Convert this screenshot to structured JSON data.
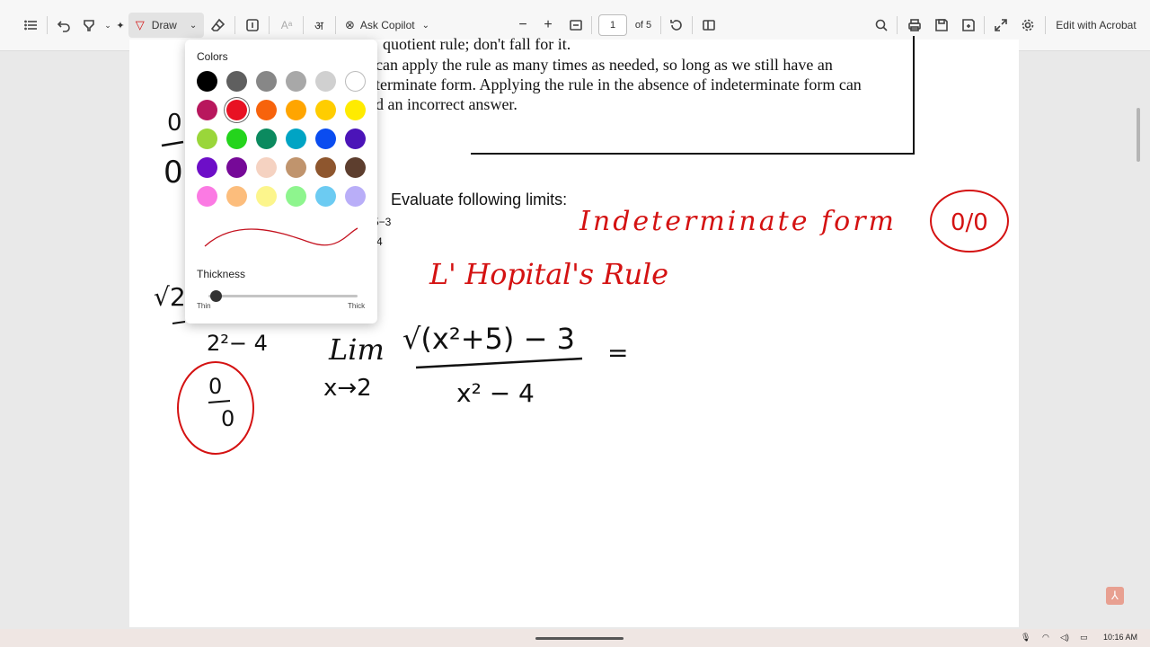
{
  "toolbar": {
    "draw_label": "Draw",
    "ask_copilot_label": "Ask Copilot",
    "page_number": "1",
    "page_total": "of 5",
    "edit_acrobat_label": "Edit with Acrobat"
  },
  "document": {
    "lines": [
      "quotient rule; don't fall for it.",
      "can apply the rule as many times as needed, so long as we still have an",
      "terminate form. Applying the rule in the absence of indeterminate form can",
      "d an incorrect answer."
    ],
    "exercise_heading": "Evaluate following limits:",
    "fragment_top": "5−3",
    "fragment_bottom": "4"
  },
  "handwriting": {
    "left_zero_top": "0",
    "left_zero_bottom": "0",
    "indeterminate": "Indeterminate form",
    "circled": "0/0",
    "lhopital": "L' Hopital's Rule",
    "lim": "Lim",
    "under_lim": "x→2",
    "numerator": "√(x²+5) − 3",
    "denominator": "x² − 4",
    "equals": "=",
    "sqrt_fragment": "√2",
    "partial_denominator": "2²− 4",
    "circled_left_top": "0",
    "circled_left_bottom": "0"
  },
  "draw_popup": {
    "colors_label": "Colors",
    "thickness_label": "Thickness",
    "thin_label": "Thin",
    "thick_label": "Thick",
    "selected_color": "#e81123",
    "thickness_value": 0.05,
    "swatches": [
      "#000000",
      "#5f5f5f",
      "#878787",
      "#a8a8a8",
      "#d0d0d0",
      "#ffffff",
      "#b8175d",
      "#e81123",
      "#f7630c",
      "#ffa500",
      "#ffcd00",
      "#ffeb00",
      "#9ad63a",
      "#24d41c",
      "#0b8a5f",
      "#00a4c4",
      "#0a4cf0",
      "#4b14b8",
      "#6d0ec8",
      "#760998",
      "#f5d2c1",
      "#c0946d",
      "#8e562e",
      "#5d3e2e",
      "#fb7ae3",
      "#fcbd7c",
      "#fcf58c",
      "#8ef58e",
      "#6ccbf2",
      "#b9aef8"
    ]
  },
  "colors": {
    "ink_red": "#d41212",
    "ink_black": "#111111"
  },
  "taskbar": {
    "time": "10:16 AM"
  }
}
